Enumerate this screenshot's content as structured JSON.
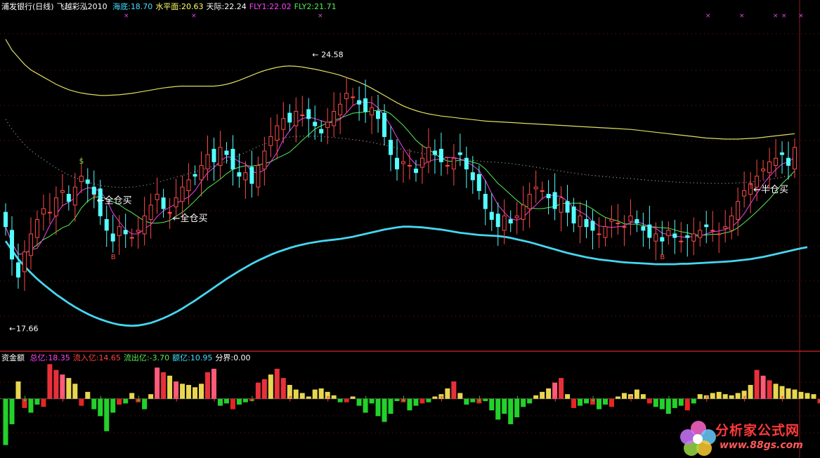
{
  "header": {
    "stock": "浦发银行(日线)",
    "indicator": "飞越彩泓2010",
    "items": [
      {
        "label": "海底:",
        "value": "18.70",
        "color": "#40e0ff"
      },
      {
        "label": "水平面:",
        "value": "20.63",
        "color": "#ffff66"
      },
      {
        "label": "天际:",
        "value": "22.24",
        "color": "#ffffff"
      },
      {
        "label": "FLY1:",
        "value": "22.02",
        "color": "#ff44ff"
      },
      {
        "label": "FLY2:",
        "value": "21.71",
        "color": "#55ee55"
      }
    ]
  },
  "sub_header": {
    "title": "资金额",
    "items": [
      {
        "label": "总亿:",
        "value": "18.35",
        "color": "#ff44ff"
      },
      {
        "label": "流入亿:",
        "value": "14.65",
        "color": "#ff4444"
      },
      {
        "label": "流出亿:",
        "value": "-3.70",
        "color": "#55ee55"
      },
      {
        "label": "额亿:",
        "value": "10.95",
        "color": "#40e0ff"
      },
      {
        "label": "分界:",
        "value": "0.00",
        "color": "#ffffff"
      }
    ]
  },
  "chart_data": {
    "type": "candlestick",
    "price_annotations": {
      "high": "24.58",
      "low": "17.66"
    },
    "signals": [
      {
        "text": "全仓买",
        "index": 14
      },
      {
        "text": "全仓买",
        "index": 26
      },
      {
        "text": "半仓买",
        "index": 118
      }
    ],
    "marks_s": [
      {
        "text": "S",
        "index": 12
      }
    ],
    "marks_b": [
      {
        "text": "B",
        "index": 17
      },
      {
        "text": "B",
        "index": 104
      }
    ],
    "closes": [
      19.6,
      18.7,
      18.2,
      18.9,
      19.4,
      19.8,
      20.1,
      20.0,
      20.4,
      20.6,
      20.3,
      20.7,
      21.0,
      20.8,
      20.5,
      19.9,
      19.5,
      19.2,
      19.6,
      19.4,
      19.3,
      19.5,
      19.9,
      20.2,
      20.5,
      20.1,
      20.0,
      20.4,
      20.7,
      20.9,
      21.0,
      21.3,
      21.6,
      21.4,
      21.8,
      21.6,
      21.2,
      21.0,
      21.1,
      20.8,
      21.3,
      21.7,
      22.1,
      22.4,
      22.6,
      22.5,
      22.8,
      22.7,
      22.6,
      22.4,
      22.2,
      22.5,
      22.8,
      23.0,
      23.3,
      23.2,
      23.0,
      22.8,
      22.9,
      22.6,
      22.1,
      21.6,
      21.2,
      21.4,
      21.3,
      21.1,
      21.5,
      21.8,
      21.6,
      21.4,
      21.3,
      21.5,
      21.6,
      21.2,
      20.9,
      20.6,
      20.1,
      19.8,
      19.6,
      19.9,
      19.7,
      19.9,
      20.2,
      20.5,
      20.7,
      20.6,
      20.4,
      20.1,
      20.4,
      20.0,
      19.7,
      19.9,
      19.6,
      19.5,
      19.4,
      19.6,
      19.8,
      19.7,
      19.6,
      19.9,
      19.7,
      19.5,
      19.3,
      19.4,
      19.2,
      19.5,
      19.3,
      19.2,
      19.3,
      19.4,
      19.5,
      19.6,
      19.5,
      19.4,
      19.6,
      19.9,
      20.3,
      20.6,
      20.8,
      21.0,
      21.2,
      21.4,
      21.5,
      21.6,
      21.3,
      21.8
    ],
    "yellow_upper": [
      24.8,
      24.5,
      24.3,
      24.1,
      23.95,
      23.85,
      23.75,
      23.65,
      23.55,
      23.47,
      23.4,
      23.35,
      23.31,
      23.28,
      23.26,
      23.24,
      23.24,
      23.25,
      23.26,
      23.28,
      23.3,
      23.33,
      23.36,
      23.39,
      23.42,
      23.45,
      23.47,
      23.49,
      23.5,
      23.5,
      23.5,
      23.5,
      23.5,
      23.5,
      23.52,
      23.55,
      23.6,
      23.66,
      23.73,
      23.8,
      23.87,
      23.93,
      23.98,
      24.02,
      24.05,
      24.06,
      24.05,
      24.03,
      24.0,
      23.97,
      23.93,
      23.89,
      23.85,
      23.8,
      23.74,
      23.68,
      23.61,
      23.53,
      23.44,
      23.34,
      23.24,
      23.14,
      23.04,
      22.95,
      22.88,
      22.82,
      22.77,
      22.73,
      22.7,
      22.67,
      22.65,
      22.63,
      22.61,
      22.59,
      22.57,
      22.55,
      22.53,
      22.52,
      22.51,
      22.5,
      22.49,
      22.48,
      22.47,
      22.46,
      22.45,
      22.44,
      22.43,
      22.42,
      22.41,
      22.4,
      22.39,
      22.38,
      22.37,
      22.36,
      22.35,
      22.34,
      22.33,
      22.32,
      22.31,
      22.3,
      22.28,
      22.26,
      22.24,
      22.22,
      22.2,
      22.18,
      22.16,
      22.14,
      22.12,
      22.1,
      22.08,
      22.06,
      22.05,
      22.04,
      22.03,
      22.03,
      22.03,
      22.04,
      22.05,
      22.06,
      22.08,
      22.1,
      22.12,
      22.14,
      22.16,
      22.18
    ],
    "cyan_lower": [
      19.2,
      18.95,
      18.7,
      18.5,
      18.32,
      18.15,
      18.0,
      17.86,
      17.72,
      17.6,
      17.48,
      17.37,
      17.27,
      17.18,
      17.1,
      17.03,
      16.97,
      16.92,
      16.88,
      16.86,
      16.85,
      16.86,
      16.89,
      16.93,
      16.99,
      17.06,
      17.14,
      17.23,
      17.33,
      17.44,
      17.55,
      17.67,
      17.79,
      17.91,
      18.03,
      18.15,
      18.26,
      18.37,
      18.47,
      18.57,
      18.66,
      18.74,
      18.82,
      18.89,
      18.95,
      19.01,
      19.06,
      19.1,
      19.14,
      19.17,
      19.2,
      19.22,
      19.24,
      19.26,
      19.29,
      19.32,
      19.36,
      19.4,
      19.44,
      19.48,
      19.52,
      19.55,
      19.58,
      19.6,
      19.6,
      19.59,
      19.58,
      19.56,
      19.54,
      19.52,
      19.49,
      19.46,
      19.43,
      19.41,
      19.39,
      19.37,
      19.36,
      19.35,
      19.34,
      19.32,
      19.29,
      19.25,
      19.21,
      19.17,
      19.12,
      19.07,
      19.02,
      18.97,
      18.92,
      18.87,
      18.83,
      18.79,
      18.75,
      18.72,
      18.69,
      18.67,
      18.65,
      18.63,
      18.61,
      18.6,
      18.59,
      18.58,
      18.57,
      18.56,
      18.56,
      18.56,
      18.56,
      18.57,
      18.57,
      18.58,
      18.59,
      18.6,
      18.61,
      18.62,
      18.63,
      18.64,
      18.66,
      18.68,
      18.7,
      18.73,
      18.76,
      18.8,
      18.84,
      18.88,
      18.92,
      18.96,
      19.0,
      19.03
    ],
    "fund_flow": [
      -4.0,
      -2.2,
      1.5,
      -0.8,
      -1.2,
      -0.5,
      -0.7,
      3.0,
      2.5,
      2.1,
      1.8,
      1.3,
      -0.6,
      0.6,
      -0.9,
      -1.5,
      -2.8,
      -1.2,
      -0.5,
      -0.4,
      0.5,
      -0.3,
      -0.9,
      0.4,
      2.7,
      2.3,
      2.0,
      1.5,
      1.3,
      1.2,
      1.0,
      1.3,
      2.3,
      2.6,
      -0.6,
      -0.4,
      -0.9,
      -0.5,
      -0.3,
      -0.2,
      1.4,
      1.7,
      2.1,
      2.6,
      1.8,
      1.2,
      0.8,
      0.5,
      0.2,
      0.8,
      0.9,
      0.6,
      0.3,
      -0.3,
      -0.3,
      0.2,
      -0.6,
      -1.2,
      -0.4,
      -1.5,
      -2.0,
      -1.3,
      -0.2,
      -0.3,
      -1.0,
      -0.6,
      -0.4,
      -0.3,
      0.2,
      0.4,
      0.9,
      1.5,
      0.5,
      -0.5,
      -0.3,
      -0.4,
      -0.2,
      -1.0,
      -1.8,
      -1.3,
      -2.2,
      -1.6,
      -0.7,
      -0.4,
      0.3,
      0.6,
      0.9,
      1.4,
      1.8,
      0.4,
      -0.8,
      -0.6,
      -0.4,
      -0.5,
      -0.9,
      -0.5,
      -0.7,
      0.2,
      0.5,
      0.4,
      0.8,
      0.4,
      -0.4,
      -0.7,
      -0.9,
      -1.3,
      -0.8,
      -0.6,
      -1.0,
      -0.4,
      0.4,
      0.3,
      0.5,
      0.6,
      0.4,
      0.3,
      0.5,
      0.7,
      1.2,
      2.5,
      2.0,
      1.6,
      1.3,
      1.1,
      0.9,
      0.8,
      0.6,
      0.5,
      0.4,
      -0.4,
      0.6
    ],
    "ylim": [
      16.3,
      25.5
    ],
    "sub_ylim": [
      -5.0,
      2.9
    ]
  }
}
